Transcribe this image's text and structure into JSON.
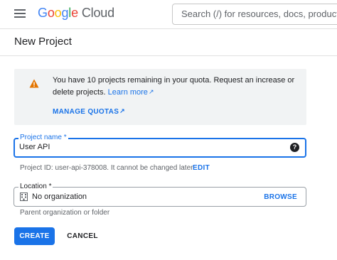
{
  "header": {
    "logo": {
      "g1": "G",
      "g2": "o",
      "g3": "o",
      "g4": "g",
      "g5": "l",
      "g6": "e",
      "product": "Cloud"
    },
    "search_placeholder": "Search (/) for resources, docs, products,"
  },
  "page": {
    "title": "New Project"
  },
  "banner": {
    "icon": "warning-icon",
    "message": "You have 10 projects remaining in your quota. Request an increase or delete projects.",
    "learn_more": "Learn more",
    "manage_quotas": "MANAGE QUOTAS"
  },
  "project_name": {
    "label": "Project name *",
    "value": "User API",
    "help_icon": "?",
    "project_id_text": "Project ID: user-api-378008. It cannot be changed later.",
    "edit_label": "EDIT"
  },
  "location": {
    "label": "Location *",
    "icon": "building-icon",
    "value": "No organization",
    "browse_label": "BROWSE",
    "helper": "Parent organization or folder"
  },
  "actions": {
    "create": "CREATE",
    "cancel": "CANCEL"
  },
  "colors": {
    "primary": "#1a73e8",
    "warning": "#e37400",
    "banner_bg": "#f1f3f4"
  }
}
